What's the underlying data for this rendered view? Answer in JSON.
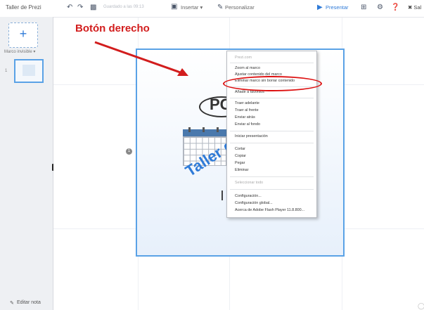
{
  "toolbar": {
    "title": "Taller de Prezi",
    "saved_status": "Guardado a las 09:13",
    "insert_label": "Insertar",
    "customize_label": "Personalizar",
    "present_label": "Presentar",
    "exit_label": "Sal"
  },
  "sidebar": {
    "frame_label": "Marco invisible",
    "thumbnail_number": "1",
    "edit_notes_label": "Editar nota"
  },
  "canvas": {
    "logo_text": "PC",
    "frame_title": "Taller de"
  },
  "annotation": {
    "label": "Botón derecho",
    "color": "#d21d1d"
  },
  "context_menu": {
    "header": "Prezi.com",
    "items": {
      "zoom_frame": "Zoom al marco",
      "adjust_content": "Ajustar contenido del marco",
      "delete_frame": "Eliminar marco sin borrar contenido",
      "add_favorites": "Añadir a favoritos",
      "bring_forward": "Traer adelante",
      "bring_front": "Traer al frente",
      "send_backward": "Enviar atrás",
      "send_back": "Enviar al fondo",
      "start_presentation": "Iniciar presentación",
      "cut": "Cortar",
      "copy": "Copiar",
      "paste": "Pegar",
      "delete": "Eliminar",
      "select_all": "Seleccionar todo",
      "settings": "Configuración...",
      "global_settings": "Configuración global...",
      "about_flash": "Acerca de Adobe Flash Player 11.8.800..."
    }
  },
  "colors": {
    "accent": "#2f7bd8",
    "frame_border": "#5aa2e6"
  }
}
